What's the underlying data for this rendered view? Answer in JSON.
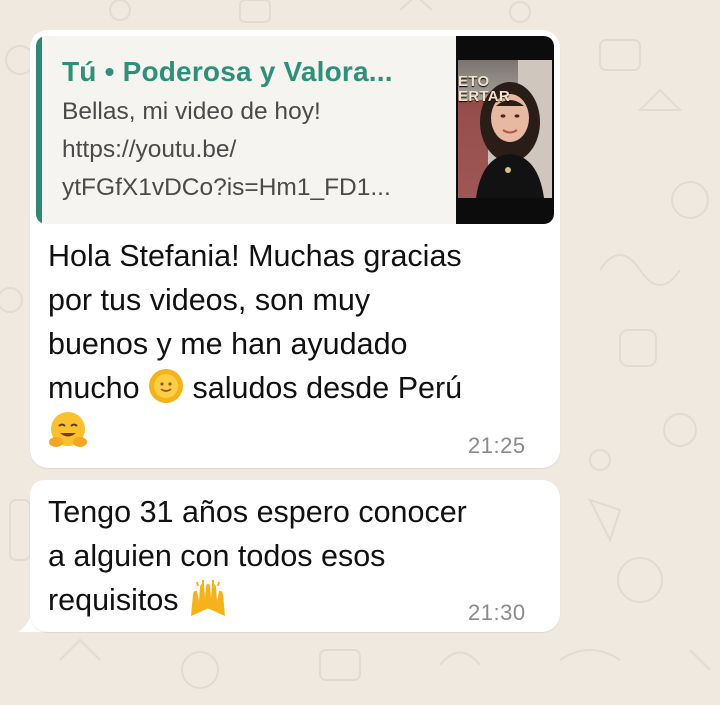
{
  "reply_quote": {
    "title": "Tú • Poderosa y Valora...",
    "line1": "Bellas, mi video de hoy!",
    "line2": "https://youtu.be/",
    "line3": "ytFGfX1vDCo?is=Hm1_FD1...",
    "thumbnail_caption_1": "ETO",
    "thumbnail_caption_2": "ERTAR"
  },
  "messages": [
    {
      "lines": [
        "Hola Stefania! Muchas gracias",
        "por tus videos, son muy",
        "buenos y me han ayudado",
        "mucho",
        "saludos desde Perú"
      ],
      "emoji_1": "sun-face",
      "emoji_2": "hugging-face",
      "time": "21:25"
    },
    {
      "lines": [
        "Tengo 31 años espero conocer",
        "a alguien con todos esos",
        "requisitos"
      ],
      "emoji": "raising-hands",
      "time": "21:30"
    }
  ],
  "colors": {
    "accent": "#2f8f78",
    "bubble": "#ffffff",
    "background": "#efe9e0"
  }
}
